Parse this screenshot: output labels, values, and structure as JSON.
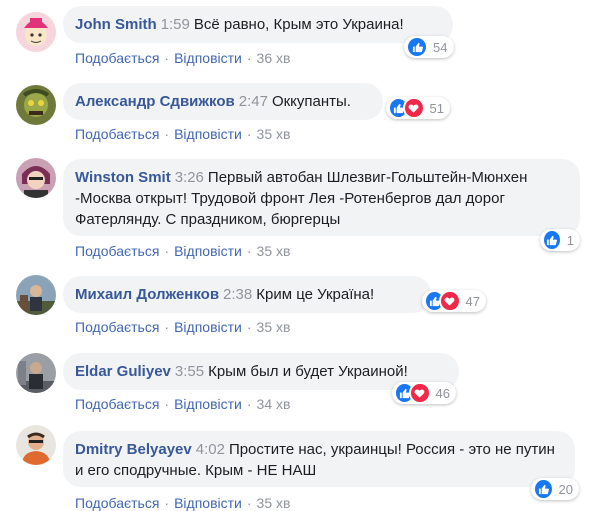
{
  "labels": {
    "like": "Подобається",
    "reply": "Відповісти"
  },
  "comments": [
    {
      "author": "John Smith",
      "time": "1:59",
      "text": "Всё равно, Крым это Украина!",
      "age": "36 хв",
      "count": "54",
      "reactions": [
        "like"
      ]
    },
    {
      "author": "Александр Сдвижков",
      "time": "2:47",
      "text": "Оккупанты.",
      "age": "35 хв",
      "count": "51",
      "reactions": [
        "like",
        "love"
      ]
    },
    {
      "author": "Winston Smit",
      "time": "3:26",
      "text": "Первый автобан Шлезвиг-Гольштейн-Мюнхен -Москва открыт! Трудовой фронт Лея -Ротенбергов дал дорог Фатерлянду. С праздником, бюргерцы",
      "age": "35 хв",
      "count": "1",
      "reactions": [
        "like"
      ]
    },
    {
      "author": "Михаил Долженков",
      "time": "2:38",
      "text": "Крим це Україна!",
      "age": "35 хв",
      "count": "47",
      "reactions": [
        "like",
        "love"
      ]
    },
    {
      "author": "Eldar Guliyev",
      "time": "3:55",
      "text": "Крым был и будет Украиной!",
      "age": "34 хв",
      "count": "46",
      "reactions": [
        "like",
        "love"
      ]
    },
    {
      "author": "Dmitry Belyayev",
      "time": "4:02",
      "text": "Простите нас, украинцы! Россия - это не путин и его сподручные. Крым - НЕ НАШ",
      "age": "35 хв",
      "count": "20",
      "reactions": [
        "like"
      ]
    }
  ],
  "colors": {
    "author": "#385898",
    "link": "#4267b2",
    "meta": "#90949c",
    "bubble": "#f2f3f5",
    "like": "#1877f2",
    "love": "#f0284a"
  },
  "icons": {
    "like": "thumbs-up-icon",
    "love": "heart-icon"
  }
}
